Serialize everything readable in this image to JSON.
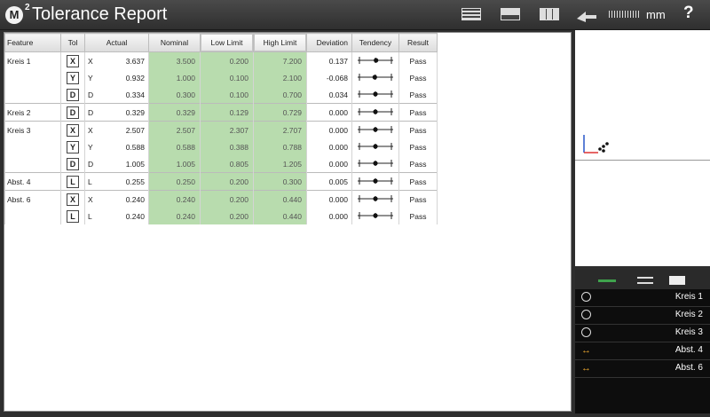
{
  "title": {
    "main": "Tolerance Report",
    "logo": "M",
    "logo_sup": "2"
  },
  "toolbar": {
    "unit": "mm",
    "help": "?",
    "icons": [
      "report-layout-icon",
      "window-icon",
      "table-icon",
      "arrow-icon",
      "ruler-icon"
    ]
  },
  "columns": [
    "Feature",
    "Tol",
    "Actual",
    "Nominal",
    "Low Limit",
    "High Limit",
    "Deviation",
    "Tendency",
    "Result"
  ],
  "rows": [
    {
      "feature": "Kreis 1",
      "tol": "X",
      "axis": "X",
      "actual": "3.637",
      "nominal": "3.500",
      "low": "0.200",
      "high": "7.200",
      "dev": "0.137",
      "tend": 0.52,
      "result": "Pass"
    },
    {
      "feature": "",
      "tol": "Y",
      "axis": "Y",
      "actual": "0.932",
      "nominal": "1.000",
      "low": "0.100",
      "high": "2.100",
      "dev": "-0.068",
      "tend": 0.48,
      "result": "Pass"
    },
    {
      "feature": "",
      "tol": "D",
      "axis": "D",
      "actual": "0.334",
      "nominal": "0.300",
      "low": "0.100",
      "high": "0.700",
      "dev": "0.034",
      "tend": 0.5,
      "result": "Pass"
    },
    {
      "feature": "Kreis 2",
      "tol": "D",
      "axis": "D",
      "actual": "0.329",
      "nominal": "0.329",
      "low": "0.129",
      "high": "0.729",
      "dev": "0.000",
      "tend": 0.5,
      "result": "Pass"
    },
    {
      "feature": "Kreis 3",
      "tol": "X",
      "axis": "X",
      "actual": "2.507",
      "nominal": "2.507",
      "low": "2.307",
      "high": "2.707",
      "dev": "0.000",
      "tend": 0.5,
      "result": "Pass"
    },
    {
      "feature": "",
      "tol": "Y",
      "axis": "Y",
      "actual": "0.588",
      "nominal": "0.588",
      "low": "0.388",
      "high": "0.788",
      "dev": "0.000",
      "tend": 0.5,
      "result": "Pass"
    },
    {
      "feature": "",
      "tol": "D",
      "axis": "D",
      "actual": "1.005",
      "nominal": "1.005",
      "low": "0.805",
      "high": "1.205",
      "dev": "0.000",
      "tend": 0.5,
      "result": "Pass"
    },
    {
      "feature": "Abst. 4",
      "tol": "L",
      "axis": "L",
      "actual": "0.255",
      "nominal": "0.250",
      "low": "0.200",
      "high": "0.300",
      "dev": "0.005",
      "tend": 0.5,
      "result": "Pass"
    },
    {
      "feature": "Abst. 6",
      "tol": "X",
      "axis": "X",
      "actual": "0.240",
      "nominal": "0.240",
      "low": "0.200",
      "high": "0.440",
      "dev": "0.000",
      "tend": 0.5,
      "result": "Pass"
    },
    {
      "feature": "",
      "tol": "L",
      "axis": "L",
      "actual": "0.240",
      "nominal": "0.240",
      "low": "0.200",
      "high": "0.440",
      "dev": "0.000",
      "tend": 0.5,
      "result": "Pass"
    }
  ],
  "features": [
    {
      "label": "Kreis 1",
      "icon": "circle-icon"
    },
    {
      "label": "Kreis 2",
      "icon": "circle-icon"
    },
    {
      "label": "Kreis 3",
      "icon": "circle-icon"
    },
    {
      "label": "Abst. 4",
      "icon": "distance-arrow-icon"
    },
    {
      "label": "Abst. 6",
      "icon": "distance-arrow-icon"
    }
  ],
  "colors": {
    "tolerance_band": "#b8dcae",
    "accent_green": "#3fa34d",
    "distance_icon": "#e6a42e"
  }
}
